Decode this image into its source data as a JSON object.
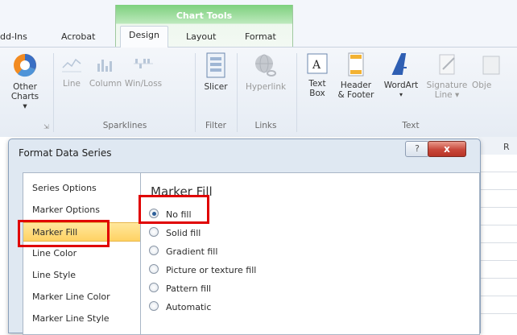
{
  "ribbon": {
    "contextual_group_title": "Chart Tools",
    "tabs": [
      "dd-Ins",
      "Acrobat",
      "Design",
      "Layout",
      "Format"
    ],
    "active_tab": "Design",
    "buttons": {
      "other_charts": "Other Charts ▾",
      "line": "Line",
      "column": "Column",
      "win_loss": "Win/Loss",
      "slicer": "Slicer",
      "hyperlink": "Hyperlink",
      "text_box": "Text Box",
      "header_footer": "Header & Footer",
      "wordart": "WordArt",
      "wordart_arrow": "▾",
      "signature_line": "Signature Line ▾",
      "object": "Obje"
    },
    "groups": {
      "sparklines": "Sparklines",
      "filter": "Filter",
      "links": "Links",
      "text": "Text"
    },
    "launcher_icon": "dialog-launcher-icon"
  },
  "sheet": {
    "column_header": "R"
  },
  "dialog": {
    "title": "Format Data Series",
    "help_label": "?",
    "close_label": "x",
    "nav_items": [
      "Series Options",
      "Marker Options",
      "Marker Fill",
      "Line Color",
      "Line Style",
      "Marker Line Color",
      "Marker Line Style"
    ],
    "selected_nav": "Marker Fill",
    "panel": {
      "heading": "Marker Fill",
      "options": [
        "No fill",
        "Solid fill",
        "Gradient fill",
        "Picture or texture fill",
        "Pattern fill",
        "Automatic"
      ],
      "selected_option": "No fill"
    }
  },
  "colors": {
    "highlight_box": "#e00000",
    "chart_tools_green": "#7dd07d",
    "selected_nav": "#ffd263",
    "close_button": "#c8473a"
  }
}
